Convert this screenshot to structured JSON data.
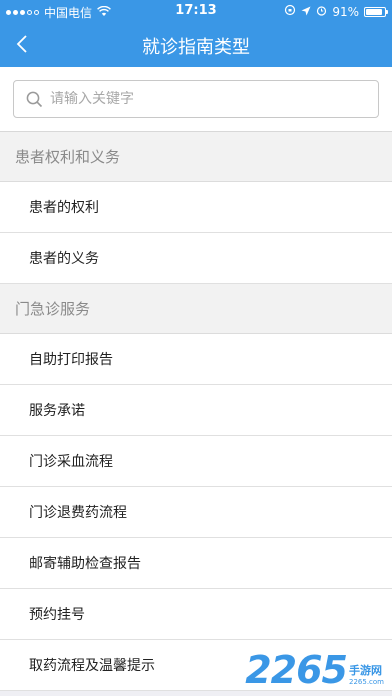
{
  "status_bar": {
    "carrier": "中国电信",
    "time": "17:13",
    "battery": "91%",
    "battery_level": 0.91
  },
  "nav": {
    "title": "就诊指南类型"
  },
  "search": {
    "placeholder": "请输入关键字"
  },
  "sections": [
    {
      "header": "患者权利和义务",
      "items": [
        "患者的权利",
        "患者的义务"
      ]
    },
    {
      "header": "门急诊服务",
      "items": [
        "自助打印报告",
        "服务承诺",
        "门诊采血流程",
        "门诊退费药流程",
        "邮寄辅助检查报告",
        "预约挂号",
        "取药流程及温馨提示"
      ]
    }
  ],
  "watermark": {
    "number": "2265",
    "cn": "手游网",
    "en": "2265.com"
  },
  "colors": {
    "accent": "#3a97e6"
  }
}
